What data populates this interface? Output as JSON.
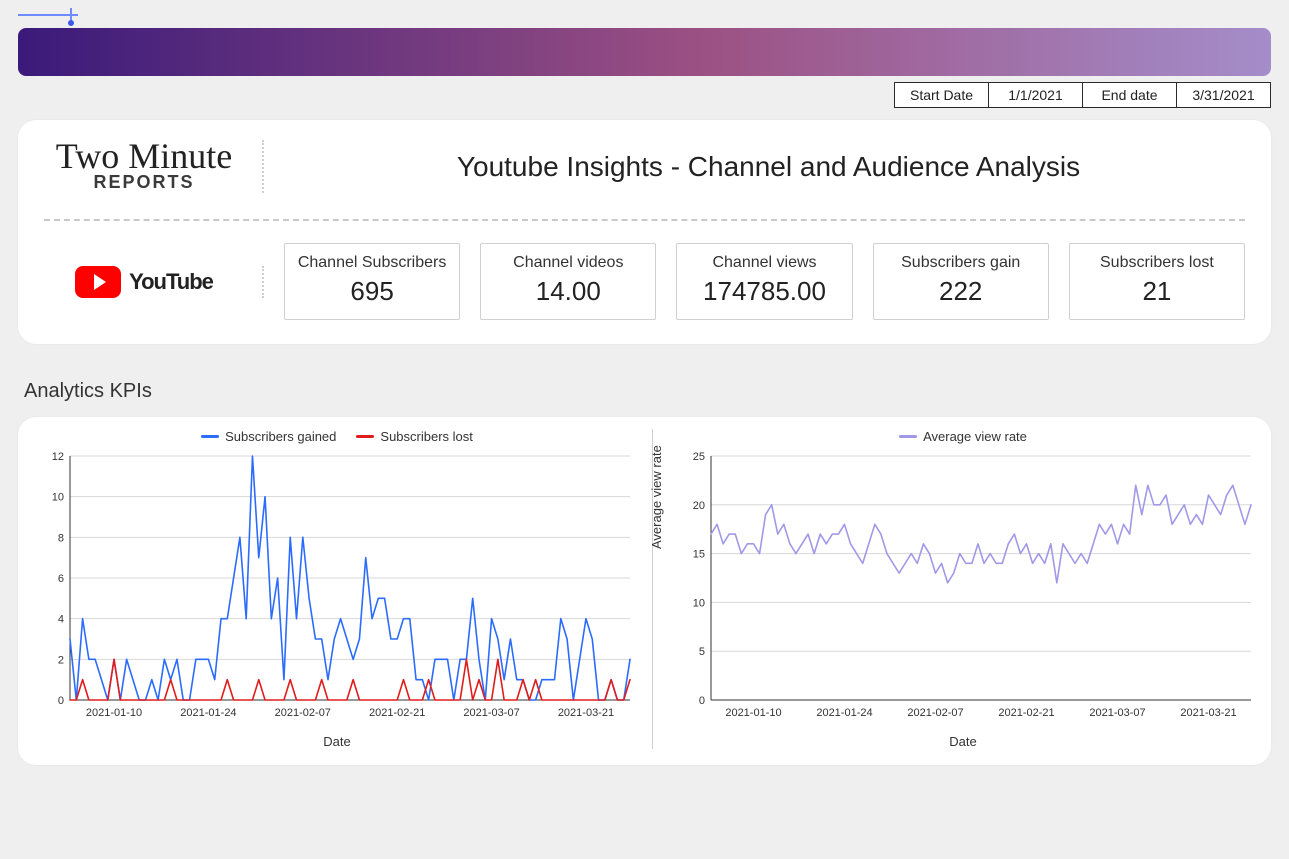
{
  "date_labels": {
    "start": "Start Date",
    "end": "End date"
  },
  "dates": {
    "start": "1/1/2021",
    "end": "3/31/2021"
  },
  "brand": {
    "line1": "Two Minute",
    "line2": "REPORTS"
  },
  "title": "Youtube Insights - Channel and Audience Analysis",
  "youtube_label": "YouTube",
  "metrics": [
    {
      "label": "Channel Subscribers",
      "value": "695"
    },
    {
      "label": "Channel videos",
      "value": "14.00"
    },
    {
      "label": "Channel views",
      "value": "174785.00"
    },
    {
      "label": "Subscribers gain",
      "value": "222"
    },
    {
      "label": "Subscribers lost",
      "value": "21"
    }
  ],
  "section_title": "Analytics KPIs",
  "legend": {
    "gained": "Subscribers gained",
    "lost": "Subscribers lost",
    "avg": "Average view rate"
  },
  "x_label": "Date",
  "y_label_right": "Average view rate",
  "chart_data": [
    {
      "type": "line",
      "title": "",
      "xlabel": "Date",
      "ylabel": "",
      "ylim": [
        0,
        12
      ],
      "x_ticks": [
        "2021-01-10",
        "2021-01-24",
        "2021-02-07",
        "2021-02-21",
        "2021-03-07",
        "2021-03-21"
      ],
      "series": [
        {
          "name": "Subscribers gained",
          "color": "#2b6cff",
          "values": [
            3,
            0,
            4,
            2,
            2,
            1,
            0,
            2,
            0,
            2,
            1,
            0,
            0,
            1,
            0,
            2,
            1,
            2,
            0,
            0,
            2,
            2,
            2,
            1,
            4,
            4,
            6,
            8,
            4,
            12,
            7,
            10,
            4,
            6,
            1,
            8,
            4,
            8,
            5,
            3,
            3,
            1,
            3,
            4,
            3,
            2,
            3,
            7,
            4,
            5,
            5,
            3,
            3,
            4,
            4,
            1,
            1,
            0,
            2,
            2,
            2,
            0,
            2,
            2,
            5,
            2,
            0,
            4,
            3,
            1,
            3,
            1,
            1,
            0,
            0,
            1,
            1,
            1,
            4,
            3,
            0,
            2,
            4,
            3,
            0,
            0,
            1,
            0,
            0,
            2
          ]
        },
        {
          "name": "Subscribers lost",
          "color": "#e01d1d",
          "values": [
            0,
            0,
            1,
            0,
            0,
            0,
            0,
            2,
            0,
            0,
            0,
            0,
            0,
            0,
            0,
            0,
            1,
            0,
            0,
            0,
            0,
            0,
            0,
            0,
            0,
            1,
            0,
            0,
            0,
            0,
            1,
            0,
            0,
            0,
            0,
            1,
            0,
            0,
            0,
            0,
            1,
            0,
            0,
            0,
            0,
            1,
            0,
            0,
            0,
            0,
            0,
            0,
            0,
            1,
            0,
            0,
            0,
            1,
            0,
            0,
            0,
            0,
            0,
            2,
            0,
            1,
            0,
            0,
            2,
            0,
            0,
            0,
            1,
            0,
            1,
            0,
            0,
            0,
            0,
            0,
            0,
            0,
            0,
            0,
            0,
            0,
            1,
            0,
            0,
            1
          ]
        }
      ]
    },
    {
      "type": "line",
      "title": "",
      "xlabel": "Date",
      "ylabel": "Average view rate",
      "ylim": [
        0,
        25
      ],
      "x_ticks": [
        "2021-01-10",
        "2021-01-24",
        "2021-02-07",
        "2021-02-21",
        "2021-03-07",
        "2021-03-21"
      ],
      "series": [
        {
          "name": "Average view rate",
          "color": "#a099e8",
          "values": [
            17,
            18,
            16,
            17,
            17,
            15,
            16,
            16,
            15,
            19,
            20,
            17,
            18,
            16,
            15,
            16,
            17,
            15,
            17,
            16,
            17,
            17,
            18,
            16,
            15,
            14,
            16,
            18,
            17,
            15,
            14,
            13,
            14,
            15,
            14,
            16,
            15,
            13,
            14,
            12,
            13,
            15,
            14,
            14,
            16,
            14,
            15,
            14,
            14,
            16,
            17,
            15,
            16,
            14,
            15,
            14,
            16,
            12,
            16,
            15,
            14,
            15,
            14,
            16,
            18,
            17,
            18,
            16,
            18,
            17,
            22,
            19,
            22,
            20,
            20,
            21,
            18,
            19,
            20,
            18,
            19,
            18,
            21,
            20,
            19,
            21,
            22,
            20,
            18,
            20
          ]
        }
      ]
    }
  ]
}
